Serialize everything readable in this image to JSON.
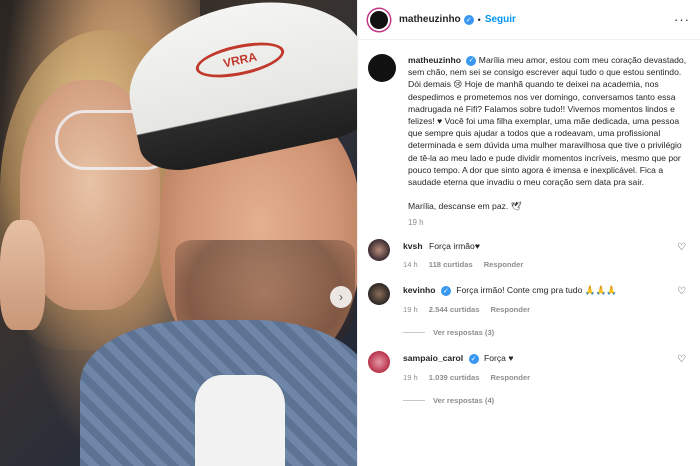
{
  "post": {
    "photo_alt": "",
    "cap_logo_text": "VRRA"
  },
  "header": {
    "username": "matheuzinho",
    "verified_mark": "✓",
    "separator": "•",
    "follow_label": "Seguir",
    "more_icon": "more-dots-icon",
    "more_glyph": "···"
  },
  "caption": {
    "username": "matheuzinho",
    "text": "Marília meu amor, estou com meu coração devastado, sem chão, nem sei se consigo escrever aqui tudo o que estou sentindo. Dói demais 😢 Hoje de manhã quando te deixei na academia, nos despedimos e prometemos nos ver domingo, conversamos tanto essa madrugada né Fifi? Falamos sobre tudo!! Vivemos momentos lindos e felizes! ♥ Você foi uma filha exemplar, uma mãe dedicada, uma pessoa que sempre quis ajudar a todos que a rodeavam, uma profissional determinada e sem dúvida uma mulher maravilhosa que tive o privilégio de tê-la ao meu lado e pude dividir momentos incríveis, mesmo que por pouco tempo. A dor que sinto agora é imensa e inexplicável. Fica a saudade eterna que invadiu o meu coração sem data pra sair.",
    "signoff": "Marília, descanse em paz. 🕊",
    "time": "19 h"
  },
  "comments": [
    {
      "username": "kvsh",
      "verified": false,
      "text": "Força irmão♥",
      "time": "14 h",
      "likes": "118 curtidas",
      "reply_label": "Responder"
    },
    {
      "username": "kevinho",
      "verified": true,
      "text": "Força irmão! Conte cmg pra tudo 🙏🙏🙏",
      "time": "19 h",
      "likes": "2.544 curtidas",
      "reply_label": "Responder",
      "view_replies": "Ver respostas (3)"
    },
    {
      "username": "sampaio_carol",
      "verified": true,
      "text": "Força ♥",
      "time": "19 h",
      "likes": "1.039 curtidas",
      "reply_label": "Responder",
      "view_replies": "Ver respostas (4)"
    }
  ],
  "icons": {
    "next": "chevron-right-icon",
    "next_glyph": "›",
    "heart_glyph": "♡"
  },
  "colors": {
    "link_blue": "#0095f6",
    "verified_blue": "#3897f0",
    "meta_gray": "#8e8e8e"
  }
}
